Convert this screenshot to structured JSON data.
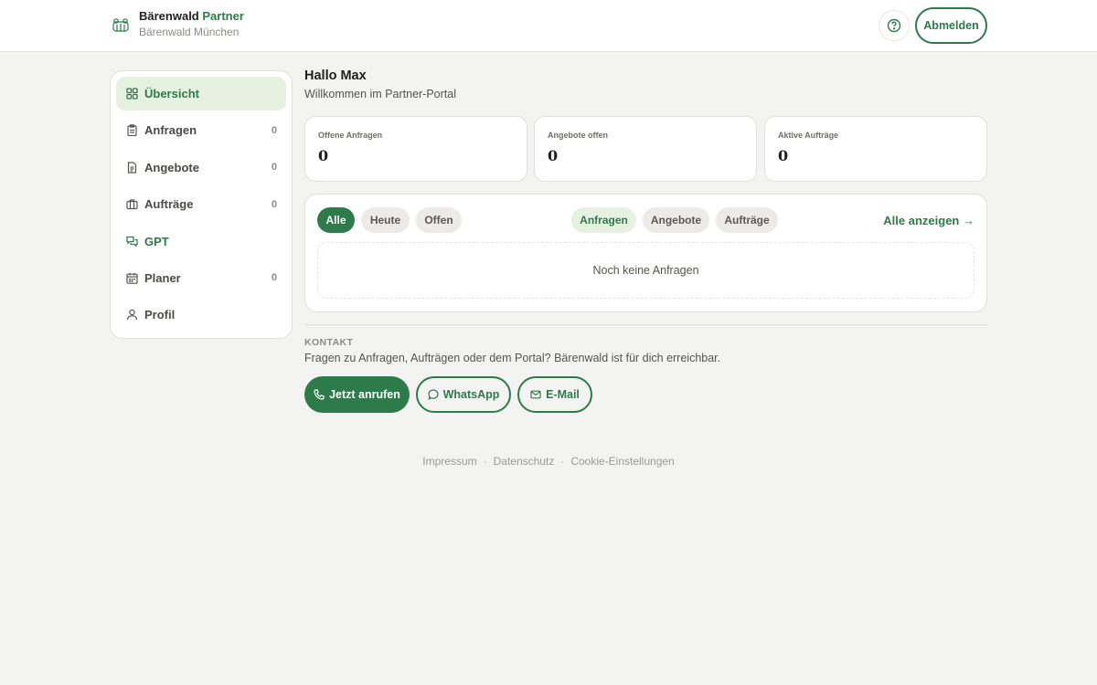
{
  "header": {
    "brand_name": "Bärenwald",
    "brand_accent": "Partner",
    "brand_sub": "Bärenwald München",
    "help_icon": "help-circle-icon",
    "logout_label": "Abmelden"
  },
  "sidebar": {
    "items": [
      {
        "label": "Übersicht",
        "icon": "grid-icon",
        "count": ""
      },
      {
        "label": "Anfragen",
        "icon": "clipboard-icon",
        "count": "0"
      },
      {
        "label": "Angebote",
        "icon": "document-icon",
        "count": "0"
      },
      {
        "label": "Aufträge",
        "icon": "briefcase-icon",
        "count": "0"
      },
      {
        "label": "GPT",
        "icon": "chat-icon",
        "count": ""
      },
      {
        "label": "Planer",
        "icon": "calendar-icon",
        "count": "0"
      },
      {
        "label": "Profil",
        "icon": "user-icon",
        "count": ""
      }
    ]
  },
  "main": {
    "greeting": "Hallo Max",
    "greeting_sub": "Willkommen im Partner-Portal",
    "stats": [
      {
        "label": "Offene Anfragen",
        "value": "0"
      },
      {
        "label": "Angebote offen",
        "value": "0"
      },
      {
        "label": "Aktive Aufträge",
        "value": "0"
      }
    ],
    "filters": {
      "time": [
        "Alle",
        "Heute",
        "Offen"
      ],
      "type": [
        "Anfragen",
        "Angebote",
        "Aufträge"
      ],
      "show_all": "Alle anzeigen →",
      "empty": "Noch keine Anfragen"
    },
    "contact": {
      "label": "KONTAKT",
      "text": "Fragen zu Anfragen, Aufträgen oder dem Portal? Bärenwald ist für dich erreichbar.",
      "call": "Jetzt anrufen",
      "whatsapp": "WhatsApp",
      "email": "E-Mail"
    }
  },
  "footer": {
    "links": [
      "Impressum",
      "Datenschutz",
      "Cookie-Einstellungen"
    ],
    "separator": "·"
  },
  "colors": {
    "accent": "#2d7a4b",
    "accent_light": "#e7f1e0",
    "background": "#f3f3f1"
  }
}
